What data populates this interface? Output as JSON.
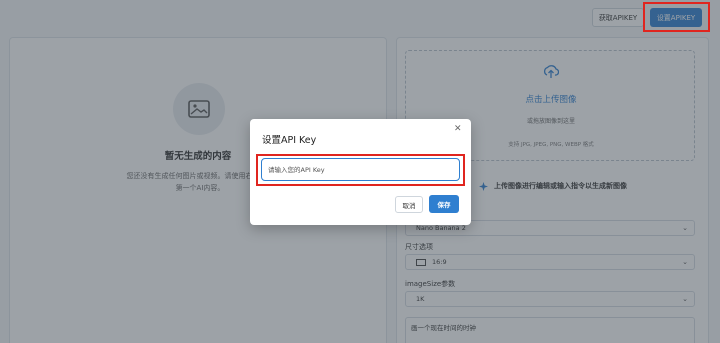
{
  "header": {
    "get_apikey_label": "获取APIKEY",
    "set_apikey_label": "设置APIKEY"
  },
  "result_panel": {
    "empty_title": "暂无生成的内容",
    "empty_desc_line1": "您还没有生成任何图片或视频。请使用右边的生",
    "empty_desc_line2": "第一个AI内容。"
  },
  "upload": {
    "title": "点击上传图像",
    "subtitle": "或拖放图像到这里",
    "formats": "支持 JPG, JPEG, PNG, WEBP 格式"
  },
  "hint": "上传图像进行编辑或输入指令以生成新图像",
  "form": {
    "model_value": "Nano Banana 2",
    "size_label": "尺寸选项",
    "size_value": "16:9",
    "image_size_label": "imageSize参数",
    "image_size_value": "1K",
    "prompt_value": "画一个现在时间的时钟"
  },
  "modal": {
    "title": "设置API Key",
    "input_placeholder": "请输入您的API Key",
    "cancel_label": "取消",
    "save_label": "保存"
  },
  "colors": {
    "primary": "#2f7fd0",
    "highlight": "#e0251f"
  }
}
